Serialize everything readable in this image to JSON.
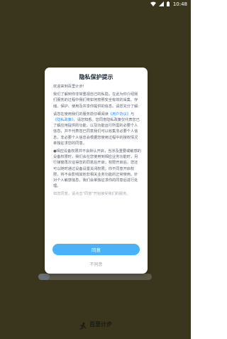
{
  "status_bar": {
    "time": "10:48",
    "icons": [
      "wifi-icon",
      "signal-icon",
      "battery-icon"
    ],
    "text_color": "#ffffff"
  },
  "background": {
    "color": "#3a361e",
    "progress": 0.1
  },
  "footer": {
    "app_name": "百里计步",
    "logo_icon": "runner-logo-icon"
  },
  "dialog": {
    "title": "隐私保护提示",
    "intro": "欢迎来到百里计步!",
    "p1": "我们了解到你非常重视自己的私隐。在此为你介绍我们服务的过程中我们将如何按照安全有效的采集、存储、保护、使用及共享你提供的信息。请您充分了解:",
    "p2_before": "请您在使用我们的服务前仔细阅读",
    "link_user_agreement": "《用户协议》",
    "and": "与",
    "link_privacy_policy": "《隐私政策》",
    "p2_after": "，请您知悉。您同意隐私政策仅代表您已了解应用提供的功能，以及功能运行所需的必要个人信息，并不代表您已同意我们可以收集非必要个人信息，非必要个人信息会根据您使用过程中的授权情况单独征求您的同意。",
    "p3": "●相应设备权限并不会默认开启，当涉及重要或敏感的设备权限时，我们会在您使用到相应业务功能时，另行弹窗再次征得您的同意后开启；权限开启后，您还可以随时通过设备设置关闭权限；你不同意开启权限，将不会影响其他非相关业务功能的正常使用。针对个人敏感信息，我们会单独征求你的同意后进行处理。",
    "p4": "如您同意，请点击\"同意\"开始接受我们的服务。",
    "agree_label": "同意",
    "disagree_label": "不同意",
    "accent_color": "#4ab2f6",
    "link_color": "#2d8df5"
  }
}
